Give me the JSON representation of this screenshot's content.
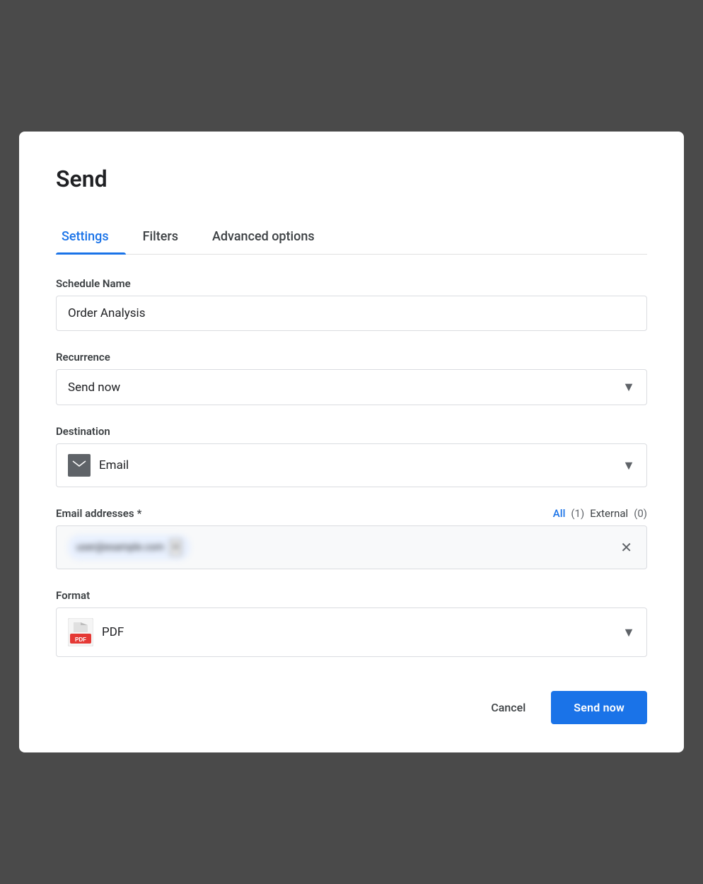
{
  "dialog": {
    "title": "Send",
    "tabs": [
      {
        "id": "settings",
        "label": "Settings",
        "active": true
      },
      {
        "id": "filters",
        "label": "Filters",
        "active": false
      },
      {
        "id": "advanced",
        "label": "Advanced options",
        "active": false
      }
    ],
    "fields": {
      "schedule_name": {
        "label": "Schedule Name",
        "value": "Order Analysis"
      },
      "recurrence": {
        "label": "Recurrence",
        "value": "Send now"
      },
      "destination": {
        "label": "Destination",
        "value": "Email"
      },
      "email_addresses": {
        "label": "Email addresses",
        "required": true,
        "filter_all_label": "All",
        "filter_all_count": "(1)",
        "filter_external_label": "External",
        "filter_external_count": "(0)"
      },
      "format": {
        "label": "Format",
        "value": "PDF"
      }
    },
    "footer": {
      "cancel_label": "Cancel",
      "send_label": "Send now"
    }
  }
}
